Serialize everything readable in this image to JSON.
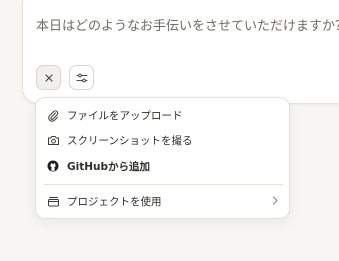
{
  "composer": {
    "placeholder": "本日はどのようなお手伝いをさせていただけますか？"
  },
  "menu": {
    "items": [
      {
        "label": "ファイルをアップロード",
        "icon": "paperclip-icon"
      },
      {
        "label": "スクリーンショットを撮る",
        "icon": "camera-icon"
      },
      {
        "label": "GitHubから追加",
        "icon": "github-icon"
      },
      {
        "label": "プロジェクトを使用",
        "icon": "folder-stack-icon",
        "has_submenu": true
      }
    ]
  },
  "colors": {
    "background": "#f7f6f2",
    "panel": "#ffffff",
    "text": "#2f2e2b",
    "muted_text": "#6f6c66",
    "border": "#e3e0d9"
  }
}
